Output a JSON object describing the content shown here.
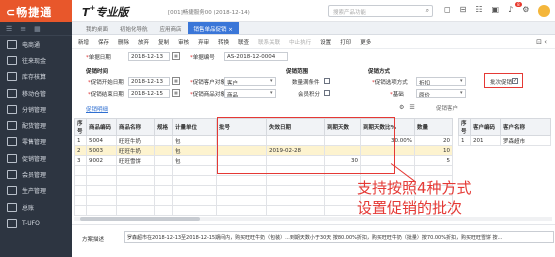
{
  "app": {
    "logo": "⊂畅捷通",
    "product": "T",
    "product_sup": "+",
    "product_suffix": "专业版",
    "company": "[001]畅捷服务00  (2018-12-14)"
  },
  "search": {
    "placeholder": "搜索产品功能"
  },
  "notifications": {
    "count": "8"
  },
  "sidebar": {
    "items": [
      {
        "label": "电商通",
        "icon": "cart-icon"
      },
      {
        "label": "往来现金",
        "icon": "exchange-icon"
      },
      {
        "label": "库存核算",
        "icon": "box-icon"
      },
      {
        "label": "移动仓管",
        "icon": "mobile-icon"
      },
      {
        "label": "分销管理",
        "icon": "network-icon"
      },
      {
        "label": "配货管理",
        "icon": "truck-icon"
      },
      {
        "label": "零售管理",
        "icon": "store-icon"
      },
      {
        "label": "促销管理",
        "icon": "promo-icon"
      },
      {
        "label": "会员管理",
        "icon": "member-icon"
      },
      {
        "label": "生产管理",
        "icon": "factory-icon"
      },
      {
        "label": "总账",
        "icon": "ledger-icon"
      },
      {
        "label": "T-UFO",
        "icon": "report-icon"
      }
    ]
  },
  "tabs": [
    {
      "label": "我的桌面"
    },
    {
      "label": "初始化导航"
    },
    {
      "label": "应用商店"
    },
    {
      "label": "销售单品促销 ×",
      "active": true
    }
  ],
  "toolbar": [
    "新增",
    "保存",
    "删除",
    "放弃",
    "复制",
    "审核",
    "弃审",
    "转换",
    "联查",
    "联系关联",
    "中止执行",
    "设置",
    "打印",
    "更多"
  ],
  "form": {
    "date_label": "单据日期",
    "date_value": "2018-12-13",
    "code_label": "单据编号",
    "code_value": "AS-2018-12-0004",
    "promo_time_header": "促销时间",
    "start_label": "促销开始日期",
    "start_value": "2018-12-13",
    "end_label": "促销结束日期",
    "end_value": "2018-12-15",
    "target_label": "促销客户对象",
    "target_value": "客户",
    "store_label": "促销商品对象",
    "store_value": "商品",
    "scope_header": "促销范围",
    "qty_cond_label": "数量满条件",
    "member_label": "会员积分",
    "method_header": "促销方式",
    "promo_type_label": "促销选项方式",
    "promo_type_value": "折扣",
    "base_label": "基础",
    "base_value": "原价",
    "batch_label": "批次促销",
    "batch_checked": "✓",
    "detail_link": "促销明细",
    "cust_tab": "促销客户"
  },
  "table": {
    "headers": [
      "序号",
      "商品编码",
      "商品名称",
      "规格",
      "计量单位",
      "批号",
      "失效日期",
      "到期天数",
      "到期天数比%",
      "数量"
    ],
    "rows": [
      [
        "1",
        "5004",
        "旺旺牛奶",
        "",
        "包",
        "",
        "",
        "",
        "30.00%",
        "20"
      ],
      [
        "2",
        "5003",
        "旺旺牛奶",
        "",
        "包",
        "",
        "2019-02-28",
        "",
        "",
        "10"
      ],
      [
        "3",
        "9002",
        "旺旺雪饼",
        "",
        "包",
        "",
        "",
        "30",
        "",
        "5"
      ]
    ]
  },
  "cust_table": {
    "headers": [
      "序号",
      "客户编码",
      "客户名称"
    ],
    "rows": [
      [
        "1",
        "201",
        "罗森超市"
      ]
    ]
  },
  "annotation": {
    "line1": "支持按照4种方式",
    "line2": "设置促销的批次"
  },
  "footer": {
    "desc_label": "方案描述",
    "desc_value": "罗森超市在2018-12-13至2018-12-15期间内，购买旺旺牛奶（包装）...到期天数小于30天 按80.00%折扣，购买旺旺牛奶（批量）按70.00%折扣，购买旺旺雪饼 按..."
  }
}
